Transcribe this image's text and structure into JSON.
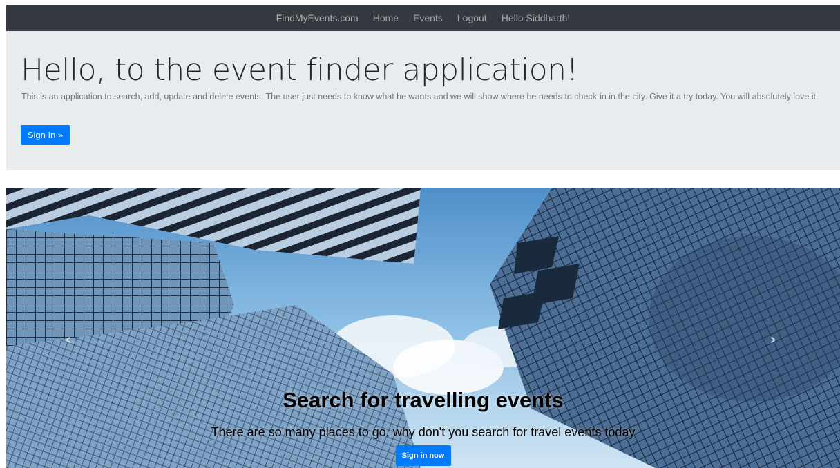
{
  "navbar": {
    "brand": "FindMyEvents.com",
    "links": [
      "Home",
      "Events",
      "Logout",
      "Hello Siddharth!"
    ]
  },
  "jumbotron": {
    "title": "Hello, to the event finder application!",
    "description": "This is an application to search, add, update and delete events. The user just needs to know what he wants and we will show where he needs to check-in in the city. Give it a try today. You will absolutely love it.",
    "button": "Sign In »"
  },
  "carousel": {
    "prev_icon": "chevron-left-icon",
    "next_icon": "chevron-right-icon",
    "prev_glyph": "‹",
    "next_glyph": "›",
    "caption_title": "Search for travelling events",
    "caption_text": "There are so many places to go, why don't you search for travel events today",
    "caption_button": "Sign in now"
  },
  "colors": {
    "navbar_bg": "#343a40",
    "jumbotron_bg": "#e9ecef",
    "primary": "#007bff"
  }
}
